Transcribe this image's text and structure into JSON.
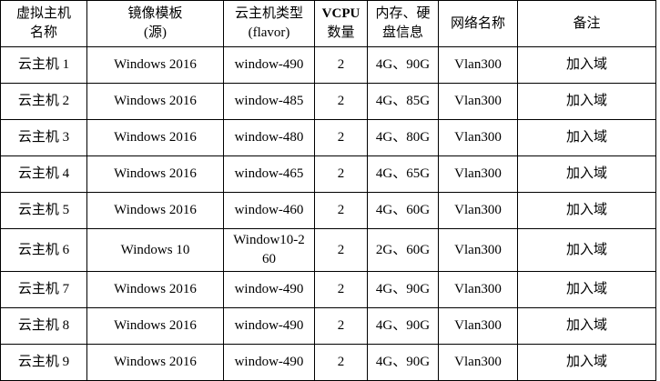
{
  "table": {
    "columns": [
      {
        "lines": [
          "虚拟主机",
          "名称"
        ]
      },
      {
        "lines": [
          "镜像模板",
          "(源)"
        ]
      },
      {
        "lines": [
          "云主机类型",
          "(flavor)"
        ]
      },
      {
        "lines": [
          "VCPU",
          "数量"
        ]
      },
      {
        "lines": [
          "内存、硬",
          "盘信息"
        ]
      },
      {
        "lines": [
          "网络名称"
        ]
      },
      {
        "lines": [
          "备注"
        ]
      }
    ],
    "rows": [
      {
        "name": "云主机 1",
        "image": "Windows 2016",
        "flavor_lines": [
          "window-490"
        ],
        "vcpu": "2",
        "mem_disk": "4G、90G",
        "network": "Vlan300",
        "note": "加入域"
      },
      {
        "name": "云主机 2",
        "image": "Windows 2016",
        "flavor_lines": [
          "window-485"
        ],
        "vcpu": "2",
        "mem_disk": "4G、85G",
        "network": "Vlan300",
        "note": "加入域"
      },
      {
        "name": "云主机 3",
        "image": "Windows 2016",
        "flavor_lines": [
          "window-480"
        ],
        "vcpu": "2",
        "mem_disk": "4G、80G",
        "network": "Vlan300",
        "note": "加入域"
      },
      {
        "name": "云主机 4",
        "image": "Windows 2016",
        "flavor_lines": [
          "window-465"
        ],
        "vcpu": "2",
        "mem_disk": "4G、65G",
        "network": "Vlan300",
        "note": "加入域"
      },
      {
        "name": "云主机 5",
        "image": "Windows 2016",
        "flavor_lines": [
          "window-460"
        ],
        "vcpu": "2",
        "mem_disk": "4G、60G",
        "network": "Vlan300",
        "note": "加入域"
      },
      {
        "name": "云主机 6",
        "image": "Windows 10",
        "flavor_lines": [
          "Window10-2",
          "60"
        ],
        "vcpu": "2",
        "mem_disk": "2G、60G",
        "network": "Vlan300",
        "note": "加入域"
      },
      {
        "name": "云主机 7",
        "image": "Windows 2016",
        "flavor_lines": [
          "window-490"
        ],
        "vcpu": "2",
        "mem_disk": "4G、90G",
        "network": "Vlan300",
        "note": "加入域"
      },
      {
        "name": "云主机 8",
        "image": "Windows 2016",
        "flavor_lines": [
          "window-490"
        ],
        "vcpu": "2",
        "mem_disk": "4G、90G",
        "network": "Vlan300",
        "note": "加入域"
      },
      {
        "name": "云主机 9",
        "image": "Windows 2016",
        "flavor_lines": [
          "window-490"
        ],
        "vcpu": "2",
        "mem_disk": "4G、90G",
        "network": "Vlan300",
        "note": "加入域"
      }
    ]
  }
}
